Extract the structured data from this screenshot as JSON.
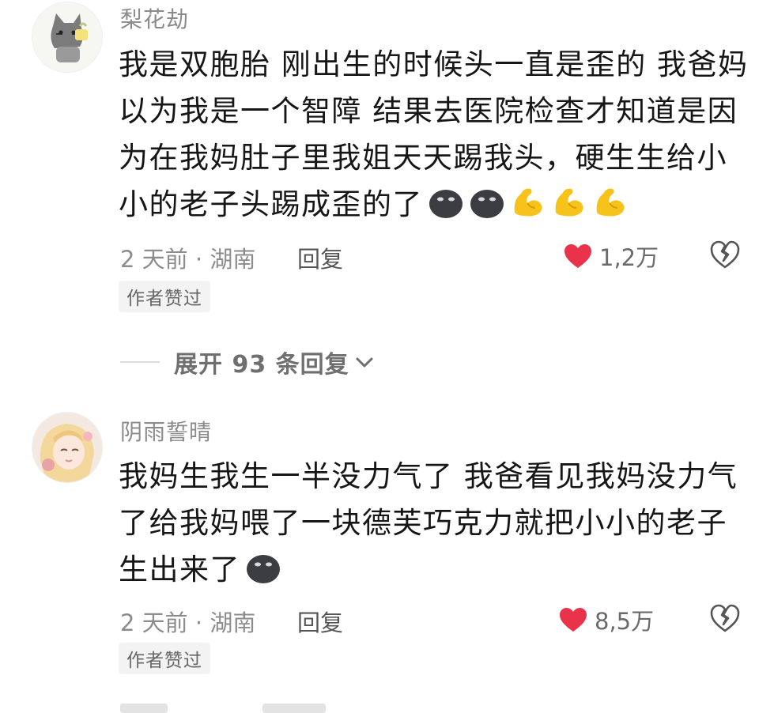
{
  "comments": [
    {
      "username": "梨花劫",
      "lines": [
        "我是双胞胎 刚出生的时候头一直是歪的 我爸妈",
        "以为我是一个智障 结果去医院检查才知道是因",
        "为在我妈肚子里我姐天天踢我头，硬生生给小",
        "小的老子头踢成歪的了"
      ],
      "emojis": [
        "black-blob-emoji",
        "black-blob-emoji",
        "yellow-muscle-emoji",
        "yellow-muscle-emoji",
        "yellow-muscle-emoji"
      ],
      "meta": "2 天前 · 湖南",
      "reply_label": "回复",
      "likes": "1,2万",
      "badge": "作者赞过"
    },
    {
      "username": "阴雨誓晴",
      "lines": [
        "我妈生我生一半没力气了 我爸看见我妈没力气",
        "了给我妈喂了一块德芙巧克力就把小小的老子",
        "生出来了"
      ],
      "emojis": [
        "black-blob-emoji"
      ],
      "meta": "2 天前 · 湖南",
      "reply_label": "回复",
      "likes": "8,5万",
      "badge": "作者赞过"
    }
  ],
  "expand_replies": "展开 93 条回复",
  "colors": {
    "like_heart": "#e8334a",
    "meta_text": "#8c8c8c",
    "username": "#8a8a8a"
  }
}
